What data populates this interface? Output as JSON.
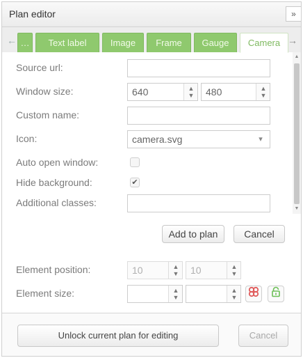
{
  "window": {
    "title": "Plan editor",
    "collapse_label": "»"
  },
  "tabs": [
    {
      "label": "…",
      "active": false
    },
    {
      "label": "Text label",
      "active": false
    },
    {
      "label": "Image",
      "active": false
    },
    {
      "label": "Frame",
      "active": false
    },
    {
      "label": "Gauge",
      "active": false
    },
    {
      "label": "Camera",
      "active": true
    }
  ],
  "tab_scroll": {
    "left": "←",
    "right": "→"
  },
  "form": {
    "source_url": {
      "label": "Source url:",
      "value": ""
    },
    "window_size": {
      "label": "Window size:",
      "width": "640",
      "height": "480"
    },
    "custom_name": {
      "label": "Custom name:",
      "value": ""
    },
    "icon": {
      "label": "Icon:",
      "value": "camera.svg"
    },
    "auto_open_window": {
      "label": "Auto open window:",
      "checked": false
    },
    "hide_background": {
      "label": "Hide background:",
      "checked": true,
      "mark": "✔"
    },
    "additional_classes": {
      "label": "Additional classes:",
      "value": ""
    }
  },
  "actions": {
    "add_label": "Add to plan",
    "cancel_label": "Cancel"
  },
  "element": {
    "position_label": "Element position:",
    "pos_x": "10",
    "pos_y": "10",
    "size_label": "Element size:",
    "size_w": "",
    "size_h": ""
  },
  "footer": {
    "unlock_label": "Unlock current plan for editing",
    "cancel_label": "Cancel"
  },
  "colors": {
    "tab_green": "#8fc96e",
    "danger": "#e05a5a",
    "success": "#6cbf57"
  }
}
